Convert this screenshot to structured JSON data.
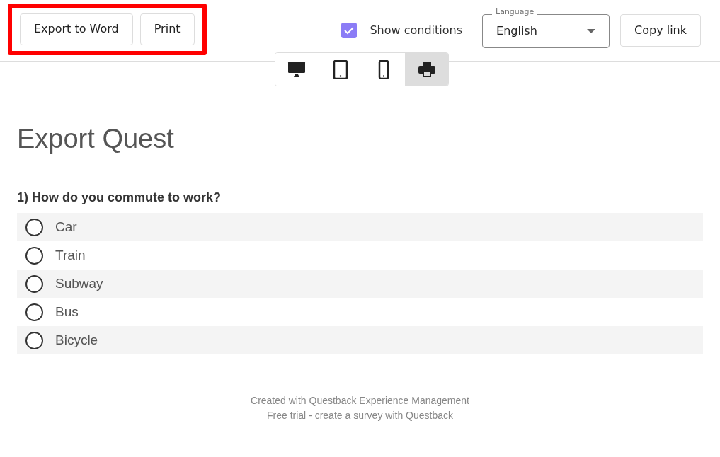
{
  "toolbar": {
    "buttons": [
      "Export to Word",
      "Print"
    ],
    "show_conditions": {
      "label": "Show conditions",
      "checked": true
    },
    "language": {
      "label": "Language",
      "value": "English"
    },
    "copy_link": "Copy link"
  },
  "device_tabs": [
    {
      "kind": "desktop",
      "selected": false
    },
    {
      "kind": "tablet",
      "selected": false
    },
    {
      "kind": "phone",
      "selected": false
    },
    {
      "kind": "print",
      "selected": true
    }
  ],
  "survey": {
    "title": "Export Quest",
    "questions": [
      {
        "number": "1)",
        "text": "How do you commute to work?",
        "options": [
          {
            "label": "Car",
            "selected": false
          },
          {
            "label": "Train",
            "selected": false
          },
          {
            "label": "Subway",
            "selected": false
          },
          {
            "label": "Bus",
            "selected": false
          },
          {
            "label": "Bicycle",
            "selected": false
          }
        ]
      }
    ]
  },
  "footer": [
    "Created with Questback Experience Management",
    "Free trial - create a survey with Questback"
  ]
}
